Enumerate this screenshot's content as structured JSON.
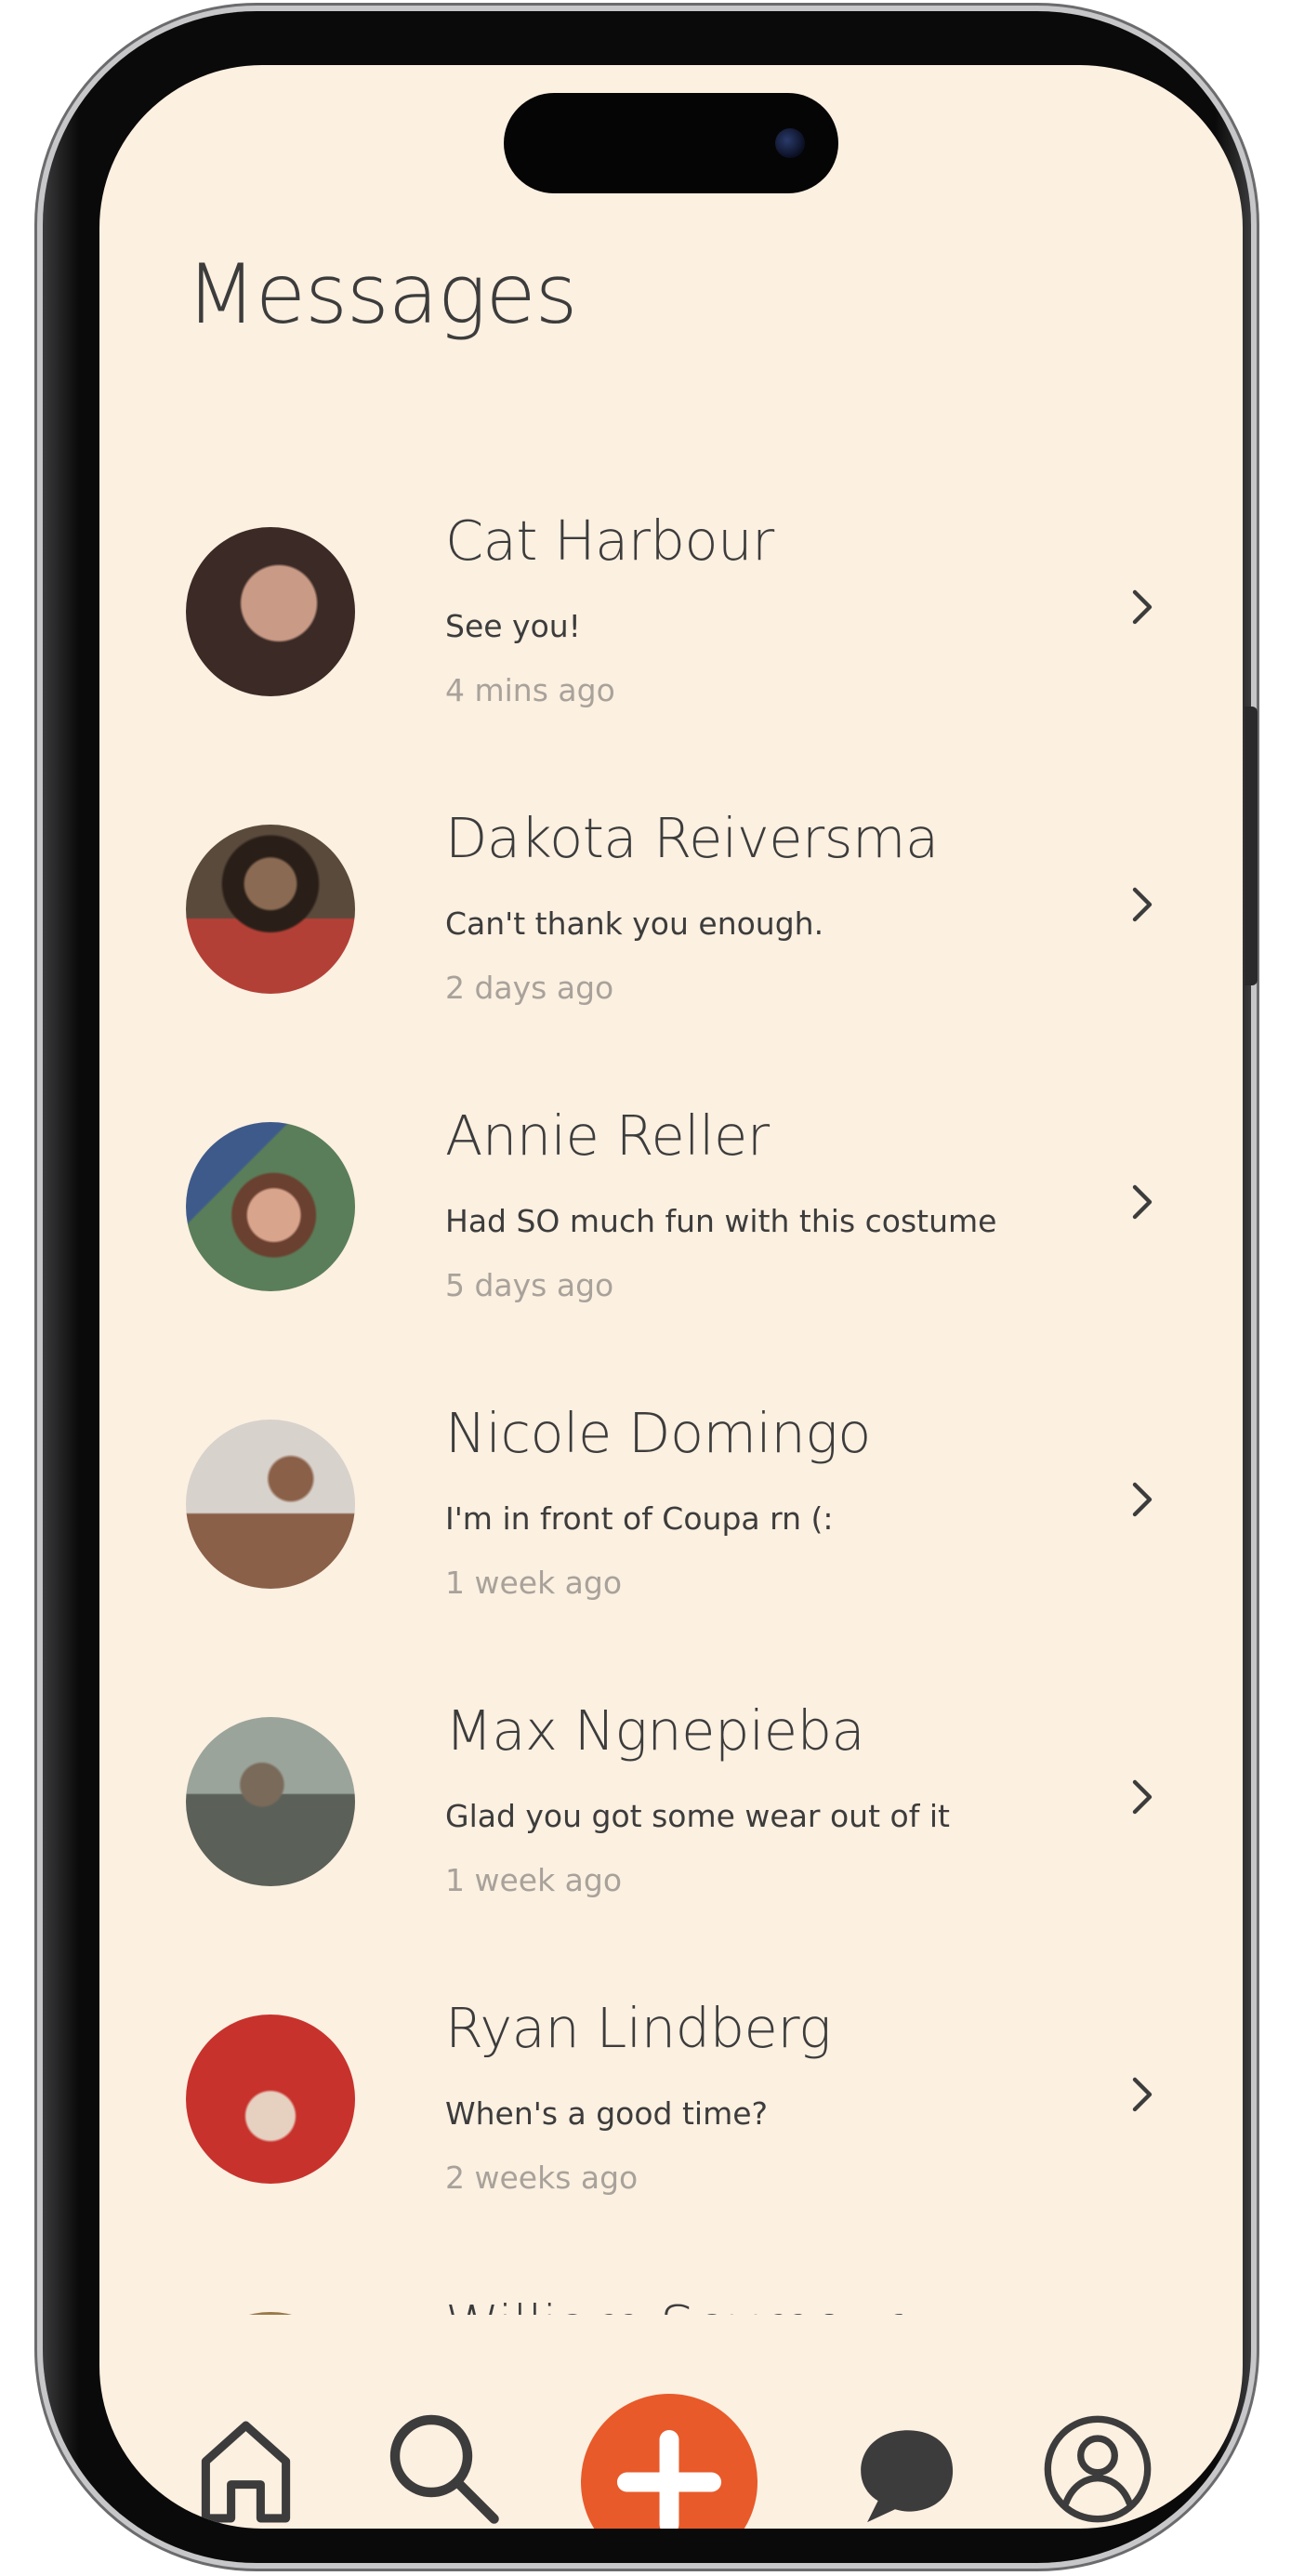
{
  "header": {
    "title": "Messages"
  },
  "conversations": [
    {
      "name": "Cat Harbour",
      "preview": "See you!",
      "time": "4 mins ago",
      "avatar_colors": [
        "#c99a86",
        "#3b2a25"
      ]
    },
    {
      "name": "Dakota Reiversma",
      "preview": "Can't thank you enough.",
      "time": "2 days ago",
      "avatar_colors": [
        "#b34036",
        "#5a4a3c"
      ]
    },
    {
      "name": "Annie Reller",
      "preview": "Had SO much fun with this costume",
      "time": "5 days ago",
      "avatar_colors": [
        "#5a7e59",
        "#3e5a8a"
      ]
    },
    {
      "name": "Nicole Domingo",
      "preview": "I'm in front of Coupa rn (:",
      "time": "1 week ago",
      "avatar_colors": [
        "#d8d2cc",
        "#8a6048"
      ]
    },
    {
      "name": "Max Ngnepieba",
      "preview": "Glad you got some wear out of it",
      "time": "1 week ago",
      "avatar_colors": [
        "#9aa49a",
        "#5b6058"
      ]
    },
    {
      "name": "Ryan Lindberg",
      "preview": "When's a good time?",
      "time": "2 weeks ago",
      "avatar_colors": [
        "#c8322c",
        "#e6d0c0"
      ]
    },
    {
      "name": "William Seymour",
      "preview": "",
      "time": "",
      "avatar_colors": [
        "#9a7848",
        "#3c3a2a"
      ]
    }
  ],
  "tab_bar": {
    "items": [
      {
        "icon": "home-icon"
      },
      {
        "icon": "search-icon"
      },
      {
        "icon": "plus-icon"
      },
      {
        "icon": "chat-bubble-icon"
      },
      {
        "icon": "user-icon"
      }
    ],
    "accent_color": "#e85a2a"
  },
  "theme": {
    "background": "#fcf0e1",
    "text": "#3c3c3c",
    "muted_text": "#a8a29a"
  }
}
